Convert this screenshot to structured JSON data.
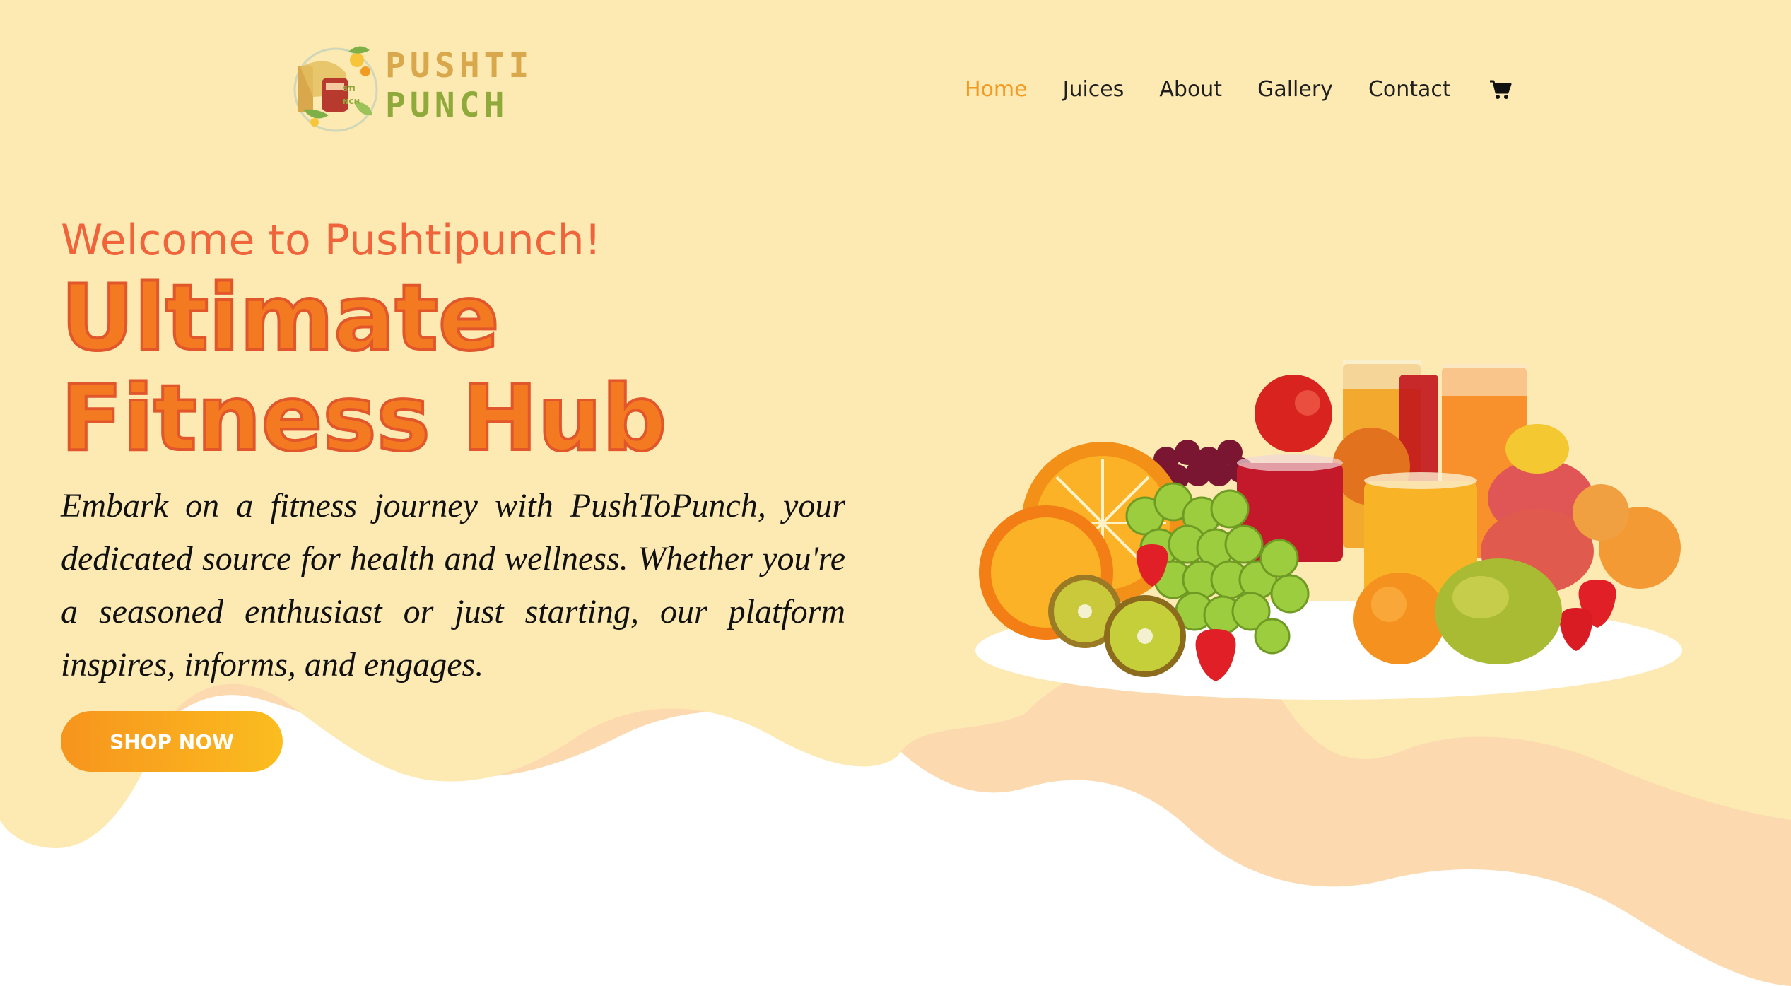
{
  "brand": {
    "line1": "PUSHTI",
    "line2": "PUNCH"
  },
  "nav": {
    "items": [
      {
        "label": "Home",
        "active": true
      },
      {
        "label": "Juices",
        "active": false
      },
      {
        "label": "About",
        "active": false
      },
      {
        "label": "Gallery",
        "active": false
      },
      {
        "label": "Contact",
        "active": false
      }
    ],
    "cart_icon": "shopping-cart-icon"
  },
  "hero": {
    "welcome": "Welcome to Pushtipunch!",
    "headline": "Ultimate Fitness Hub",
    "description": "Embark on a fitness journey with PushToPunch, your dedicated source for health and wellness. Whether you're a seasoned enthusiast or just starting, our platform inspires, informs, and engages.",
    "cta_label": "SHOP NOW"
  },
  "colors": {
    "background_top": "#fde9b2",
    "wave_peach": "#fcd9ae",
    "accent_orange": "#f47a22",
    "welcome_red_orange": "#f0643c",
    "nav_active": "#f39a22",
    "logo_gold": "#d9a84c",
    "logo_green": "#8faa3a",
    "button_gradient_start": "#f7941d",
    "button_gradient_end": "#fbbd1f"
  }
}
